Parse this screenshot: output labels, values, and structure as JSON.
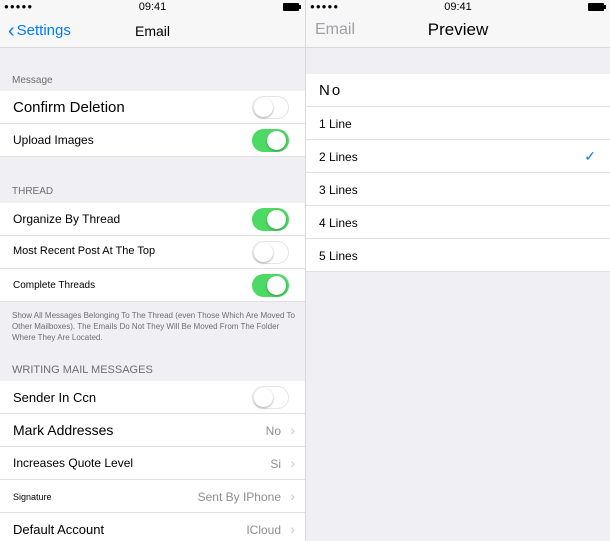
{
  "left": {
    "status": {
      "carrier": "●●●●● ",
      "time": "09:41"
    },
    "nav": {
      "back": "Settings",
      "title": "Email"
    },
    "sections": {
      "message": {
        "header": "Message",
        "rows": [
          {
            "label": "Confirm Deletion",
            "toggle": false
          },
          {
            "label": "Upload Images",
            "toggle": true
          }
        ]
      },
      "thread": {
        "header": "THREAD",
        "rows": [
          {
            "label": "Organize By Thread",
            "toggle": true
          },
          {
            "label": "Most Recent Post At The Top",
            "toggle": false
          },
          {
            "label": "Complete Threads",
            "toggle": true
          }
        ],
        "footer": "Show All Messages Belonging To The Thread (even Those Which Are Moved To Other Mailboxes). The Emails Do Not They Will Be Moved From The Folder Where They Are Located."
      },
      "writing": {
        "header": "WRITING MAIL MESSAGES",
        "rows": [
          {
            "label": "Sender In Ccn",
            "toggle": false
          },
          {
            "label": "Mark Addresses",
            "value": "No"
          },
          {
            "label": "Increases Quote Level",
            "value": "Si"
          },
          {
            "label": "Signature",
            "value": "Sent By IPhone"
          },
          {
            "label": "Default Account",
            "value": "ICloud"
          }
        ]
      }
    }
  },
  "right": {
    "status": {
      "carrier": "●●●●● ",
      "time": "09:41"
    },
    "nav": {
      "back": "Email",
      "title": "Preview"
    },
    "options": [
      {
        "label": "No",
        "selected": false
      },
      {
        "label": "1 Line",
        "selected": false
      },
      {
        "label": "2 Lines",
        "selected": true
      },
      {
        "label": "3 Lines",
        "selected": false
      },
      {
        "label": "4 Lines",
        "selected": false
      },
      {
        "label": "5 Lines",
        "selected": false
      }
    ],
    "check_glyph": "✓"
  },
  "colors": {
    "accent": "#007aff",
    "toggle_on": "#4cd964",
    "background": "#efeff4"
  }
}
